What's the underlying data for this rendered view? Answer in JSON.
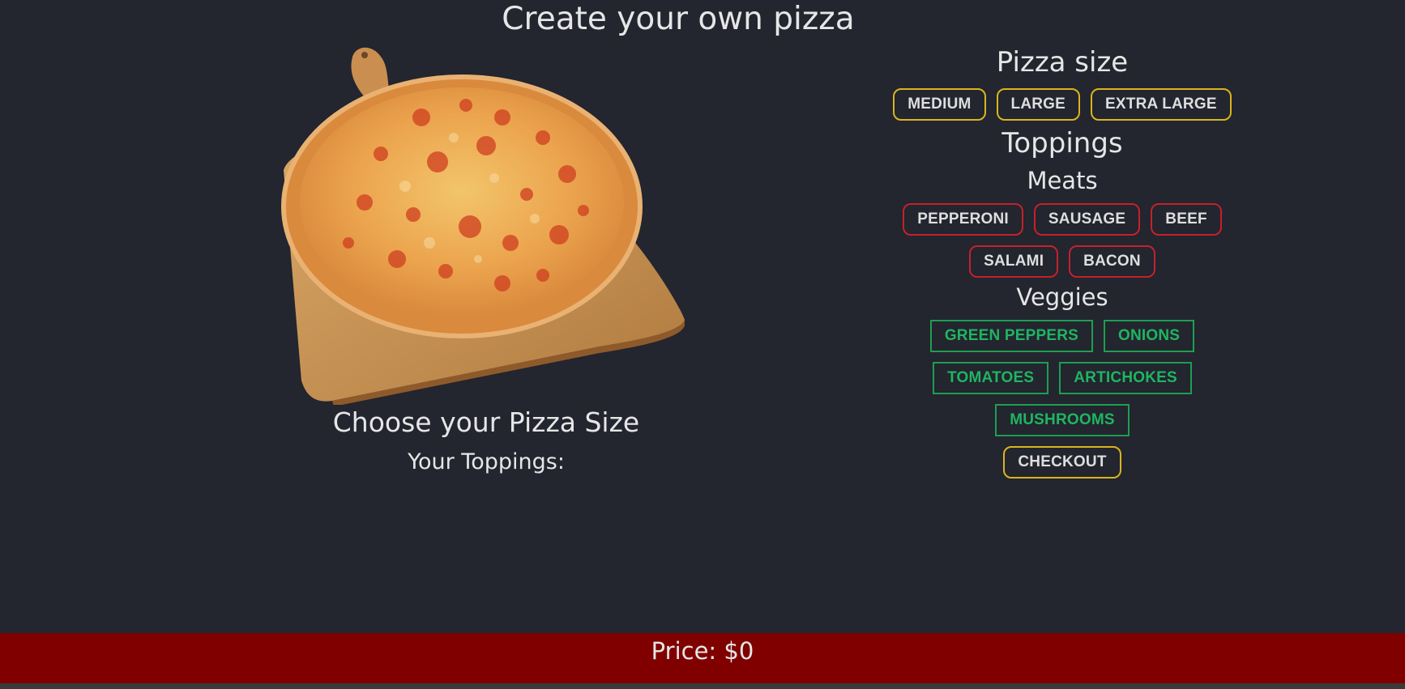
{
  "page": {
    "title": "Create your own pizza"
  },
  "left": {
    "pizza_image": "pizza-on-wooden-board",
    "choose_size_label": "Choose your Pizza Size",
    "toppings_label": "Your Toppings:"
  },
  "size_section": {
    "heading": "Pizza size",
    "options": [
      "MEDIUM",
      "LARGE",
      "EXTRA LARGE"
    ]
  },
  "toppings_section": {
    "heading": "Toppings",
    "meats": {
      "heading": "Meats",
      "items": [
        "PEPPERONI",
        "SAUSAGE",
        "BEEF",
        "SALAMI",
        "BACON"
      ]
    },
    "veggies": {
      "heading": "Veggies",
      "items": [
        "GREEN PEPPERS",
        "ONIONS",
        "TOMATOES",
        "ARTICHOKES",
        "MUSHROOMS"
      ]
    }
  },
  "checkout_label": "CHECKOUT",
  "price_text": "Price: $0",
  "colors": {
    "background": "#23252f",
    "size_border": "#d9b51d",
    "meat_border": "#c4222a",
    "veg_border": "#1e9e52",
    "veg_text": "#1fb561",
    "price_bar": "#800000"
  }
}
